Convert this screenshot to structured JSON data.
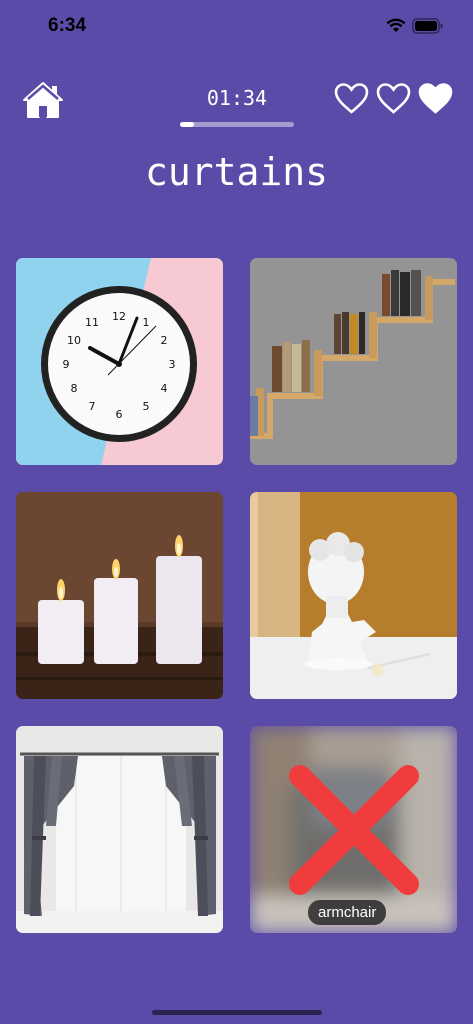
{
  "status_bar": {
    "time": "6:34"
  },
  "game": {
    "timer": "01:34",
    "progress": 0.12,
    "word": "curtains",
    "lives": [
      "heart-outline",
      "heart-outline",
      "heart-filled"
    ],
    "accent_color": "#5B4BA8"
  },
  "tiles": [
    {
      "subject": "wall-clock"
    },
    {
      "subject": "stair-bookshelf"
    },
    {
      "subject": "candles"
    },
    {
      "subject": "bust-statue"
    },
    {
      "subject": "curtains"
    },
    {
      "subject": "armchair",
      "state": "wrong",
      "label": "armchair"
    }
  ]
}
